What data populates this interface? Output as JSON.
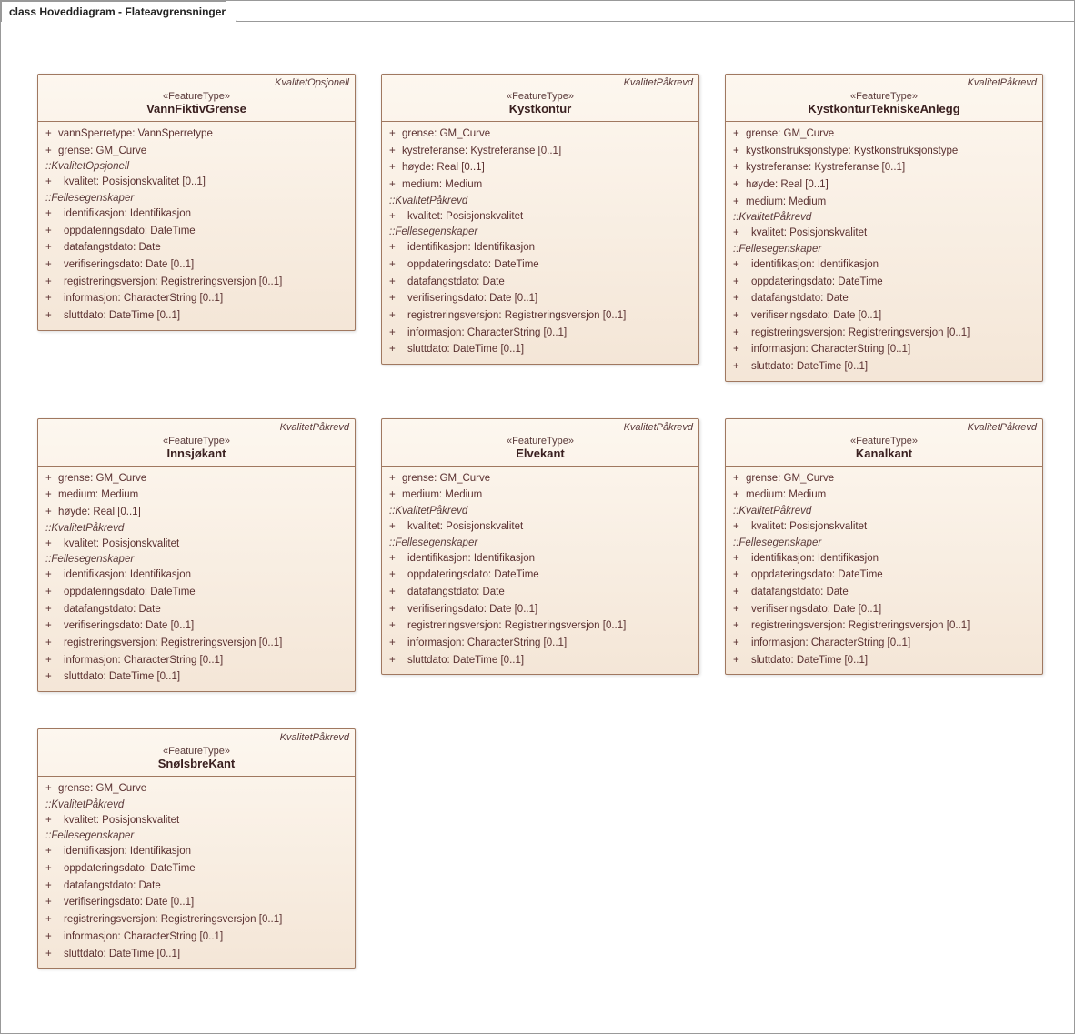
{
  "frame_title": "class Hoveddiagram - Flateavgrensninger",
  "stereo": "«FeatureType»",
  "classes": [
    {
      "name": "VannFiktivGrense",
      "tag": "KvalitetOpsjonell",
      "own_attrs": [
        "vannSperretype: VannSperretype",
        "grense: GM_Curve"
      ],
      "sections": [
        {
          "label": "::KvalitetOpsjonell",
          "attrs": [
            "kvalitet: Posisjonskvalitet [0..1]"
          ]
        },
        {
          "label": "::Fellesegenskaper",
          "attrs": [
            "identifikasjon: Identifikasjon",
            "oppdateringsdato: DateTime",
            "datafangstdato: Date",
            "verifiseringsdato: Date [0..1]",
            "registreringsversjon: Registreringsversjon [0..1]",
            "informasjon: CharacterString [0..1]",
            "sluttdato: DateTime [0..1]"
          ]
        }
      ]
    },
    {
      "name": "Kystkontur",
      "tag": "KvalitetPåkrevd",
      "own_attrs": [
        "grense: GM_Curve",
        "kystreferanse: Kystreferanse [0..1]",
        "høyde: Real [0..1]",
        "medium: Medium"
      ],
      "sections": [
        {
          "label": "::KvalitetPåkrevd",
          "attrs": [
            "kvalitet: Posisjonskvalitet"
          ]
        },
        {
          "label": "::Fellesegenskaper",
          "attrs": [
            "identifikasjon: Identifikasjon",
            "oppdateringsdato: DateTime",
            "datafangstdato: Date",
            "verifiseringsdato: Date [0..1]",
            "registreringsversjon: Registreringsversjon [0..1]",
            "informasjon: CharacterString [0..1]",
            "sluttdato: DateTime [0..1]"
          ]
        }
      ]
    },
    {
      "name": "KystkonturTekniskeAnlegg",
      "tag": "KvalitetPåkrevd",
      "own_attrs": [
        "grense: GM_Curve",
        "kystkonstruksjonstype: Kystkonstruksjonstype",
        "kystreferanse: Kystreferanse [0..1]",
        "høyde: Real [0..1]",
        "medium: Medium"
      ],
      "sections": [
        {
          "label": "::KvalitetPåkrevd",
          "attrs": [
            "kvalitet: Posisjonskvalitet"
          ]
        },
        {
          "label": "::Fellesegenskaper",
          "attrs": [
            "identifikasjon: Identifikasjon",
            "oppdateringsdato: DateTime",
            "datafangstdato: Date",
            "verifiseringsdato: Date [0..1]",
            "registreringsversjon: Registreringsversjon [0..1]",
            "informasjon: CharacterString [0..1]",
            "sluttdato: DateTime [0..1]"
          ]
        }
      ]
    },
    {
      "name": "Innsjøkant",
      "tag": "KvalitetPåkrevd",
      "own_attrs": [
        "grense: GM_Curve",
        "medium: Medium",
        "høyde: Real [0..1]"
      ],
      "sections": [
        {
          "label": "::KvalitetPåkrevd",
          "attrs": [
            "kvalitet: Posisjonskvalitet"
          ]
        },
        {
          "label": "::Fellesegenskaper",
          "attrs": [
            "identifikasjon: Identifikasjon",
            "oppdateringsdato: DateTime",
            "datafangstdato: Date",
            "verifiseringsdato: Date [0..1]",
            "registreringsversjon: Registreringsversjon [0..1]",
            "informasjon: CharacterString [0..1]",
            "sluttdato: DateTime [0..1]"
          ]
        }
      ]
    },
    {
      "name": "Elvekant",
      "tag": "KvalitetPåkrevd",
      "own_attrs": [
        "grense: GM_Curve",
        "medium: Medium"
      ],
      "sections": [
        {
          "label": "::KvalitetPåkrevd",
          "attrs": [
            "kvalitet: Posisjonskvalitet"
          ]
        },
        {
          "label": "::Fellesegenskaper",
          "attrs": [
            "identifikasjon: Identifikasjon",
            "oppdateringsdato: DateTime",
            "datafangstdato: Date",
            "verifiseringsdato: Date [0..1]",
            "registreringsversjon: Registreringsversjon [0..1]",
            "informasjon: CharacterString [0..1]",
            "sluttdato: DateTime [0..1]"
          ]
        }
      ]
    },
    {
      "name": "Kanalkant",
      "tag": "KvalitetPåkrevd",
      "own_attrs": [
        "grense: GM_Curve",
        "medium: Medium"
      ],
      "sections": [
        {
          "label": "::KvalitetPåkrevd",
          "attrs": [
            "kvalitet: Posisjonskvalitet"
          ]
        },
        {
          "label": "::Fellesegenskaper",
          "attrs": [
            "identifikasjon: Identifikasjon",
            "oppdateringsdato: DateTime",
            "datafangstdato: Date",
            "verifiseringsdato: Date [0..1]",
            "registreringsversjon: Registreringsversjon [0..1]",
            "informasjon: CharacterString [0..1]",
            "sluttdato: DateTime [0..1]"
          ]
        }
      ]
    },
    {
      "name": "SnøIsbreKant",
      "tag": "KvalitetPåkrevd",
      "own_attrs": [
        "grense: GM_Curve"
      ],
      "sections": [
        {
          "label": "::KvalitetPåkrevd",
          "attrs": [
            "kvalitet: Posisjonskvalitet"
          ]
        },
        {
          "label": "::Fellesegenskaper",
          "attrs": [
            "identifikasjon: Identifikasjon",
            "oppdateringsdato: DateTime",
            "datafangstdato: Date",
            "verifiseringsdato: Date [0..1]",
            "registreringsversjon: Registreringsversjon [0..1]",
            "informasjon: CharacterString [0..1]",
            "sluttdato: DateTime [0..1]"
          ]
        }
      ]
    }
  ]
}
